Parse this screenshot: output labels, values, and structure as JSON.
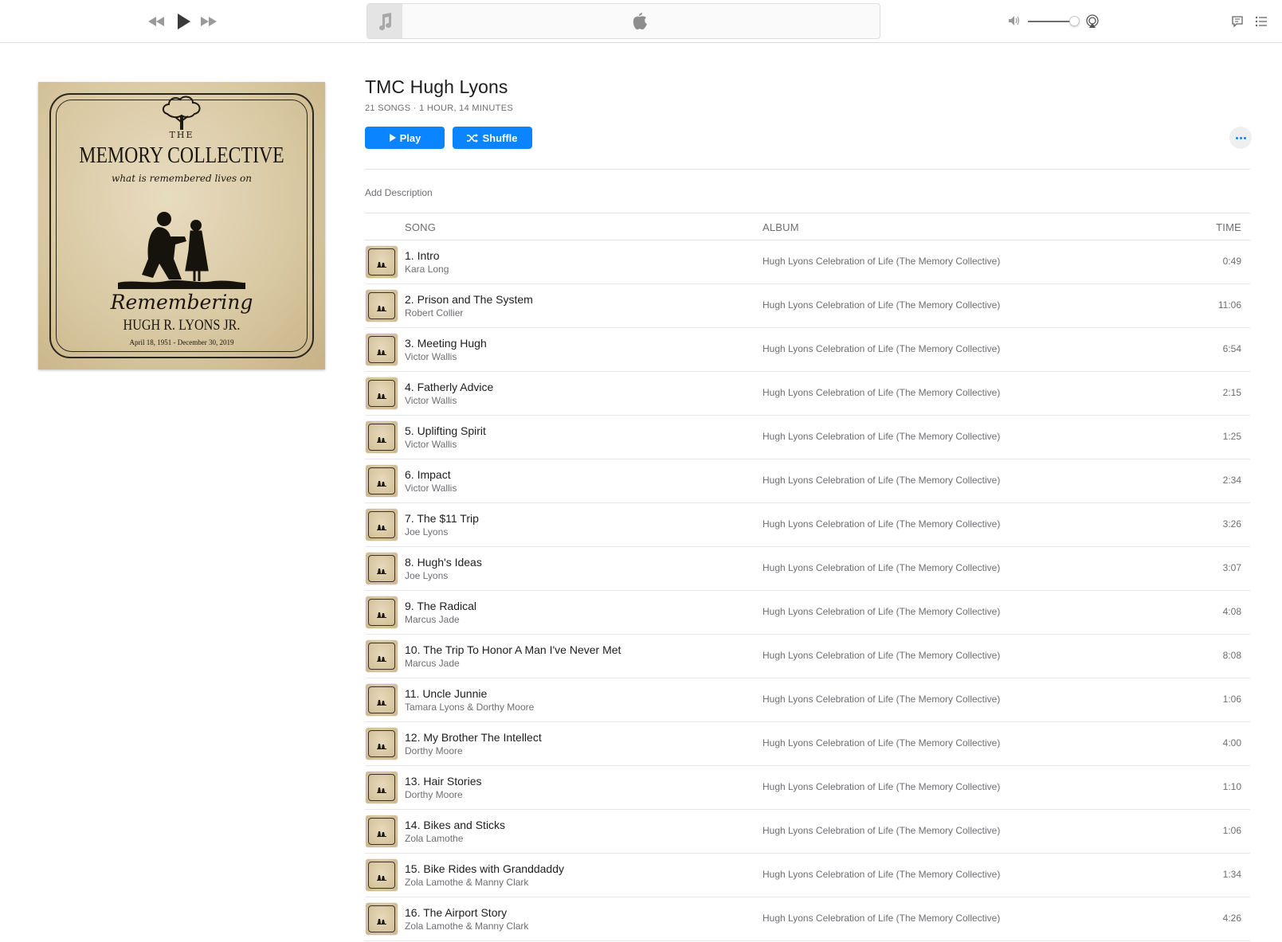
{
  "player": {
    "icons": [
      "rewind-icon",
      "play-icon",
      "fast-forward-icon",
      "music-note-icon",
      "apple-logo-icon",
      "volume-icon",
      "airplay-icon",
      "lyrics-icon",
      "queue-list-icon"
    ],
    "volume_level": 0.85
  },
  "artwork": {
    "the": "THE",
    "title": "MEMORY COLLECTIVE",
    "tagline": "what is remembered lives on",
    "remembering": "Remembering",
    "name": "HUGH R. LYONS JR.",
    "dates": "April 18, 1951 - December 30, 2019"
  },
  "playlist": {
    "title": "TMC Hugh Lyons",
    "meta": "21 SONGS · 1 HOUR, 14 MINUTES",
    "play_label": "Play",
    "shuffle_label": "Shuffle",
    "add_description": "Add Description"
  },
  "table": {
    "headers": {
      "song": "SONG",
      "album": "ALBUM",
      "time": "TIME"
    },
    "rows": [
      {
        "title": "1. Intro",
        "artist": "Kara Long",
        "album": "Hugh Lyons Celebration of Life (The Memory Collective)",
        "time": "0:49"
      },
      {
        "title": "2. Prison and The System",
        "artist": "Robert Collier",
        "album": "Hugh Lyons Celebration of Life (The Memory Collective)",
        "time": "11:06"
      },
      {
        "title": "3. Meeting Hugh",
        "artist": "Victor Wallis",
        "album": "Hugh Lyons Celebration of Life (The Memory Collective)",
        "time": "6:54"
      },
      {
        "title": "4. Fatherly Advice",
        "artist": "Victor Wallis",
        "album": "Hugh Lyons Celebration of Life (The Memory Collective)",
        "time": "2:15"
      },
      {
        "title": "5. Uplifting Spirit",
        "artist": "Victor Wallis",
        "album": "Hugh Lyons Celebration of Life (The Memory Collective)",
        "time": "1:25"
      },
      {
        "title": "6. Impact",
        "artist": "Victor Wallis",
        "album": "Hugh Lyons Celebration of Life (The Memory Collective)",
        "time": "2:34"
      },
      {
        "title": "7. The $11 Trip",
        "artist": "Joe Lyons",
        "album": "Hugh Lyons Celebration of Life (The Memory Collective)",
        "time": "3:26"
      },
      {
        "title": "8. Hugh's Ideas",
        "artist": "Joe Lyons",
        "album": "Hugh Lyons Celebration of Life (The Memory Collective)",
        "time": "3:07"
      },
      {
        "title": "9. The Radical",
        "artist": "Marcus Jade",
        "album": "Hugh Lyons Celebration of Life (The Memory Collective)",
        "time": "4:08"
      },
      {
        "title": "10. The Trip To Honor A Man I've Never Met",
        "artist": "Marcus Jade",
        "album": "Hugh Lyons Celebration of Life (The Memory Collective)",
        "time": "8:08"
      },
      {
        "title": "11. Uncle Junnie",
        "artist": "Tamara Lyons & Dorthy Moore",
        "album": "Hugh Lyons Celebration of Life (The Memory Collective)",
        "time": "1:06"
      },
      {
        "title": "12. My Brother The Intellect",
        "artist": "Dorthy Moore",
        "album": "Hugh Lyons Celebration of Life (The Memory Collective)",
        "time": "4:00"
      },
      {
        "title": "13. Hair Stories",
        "artist": "Dorthy Moore",
        "album": "Hugh Lyons Celebration of Life (The Memory Collective)",
        "time": "1:10"
      },
      {
        "title": "14. Bikes and Sticks",
        "artist": "Zola Lamothe",
        "album": "Hugh Lyons Celebration of Life (The Memory Collective)",
        "time": "1:06"
      },
      {
        "title": "15. Bike Rides with Granddaddy",
        "artist": "Zola Lamothe & Manny Clark",
        "album": "Hugh Lyons Celebration of Life (The Memory Collective)",
        "time": "1:34"
      },
      {
        "title": "16. The Airport Story",
        "artist": "Zola Lamothe & Manny Clark",
        "album": "Hugh Lyons Celebration of Life (The Memory Collective)",
        "time": "4:26"
      }
    ]
  },
  "colors": {
    "accent": "#0a84ff",
    "text": "#1d1d1f",
    "secondary": "#6e6e73"
  }
}
